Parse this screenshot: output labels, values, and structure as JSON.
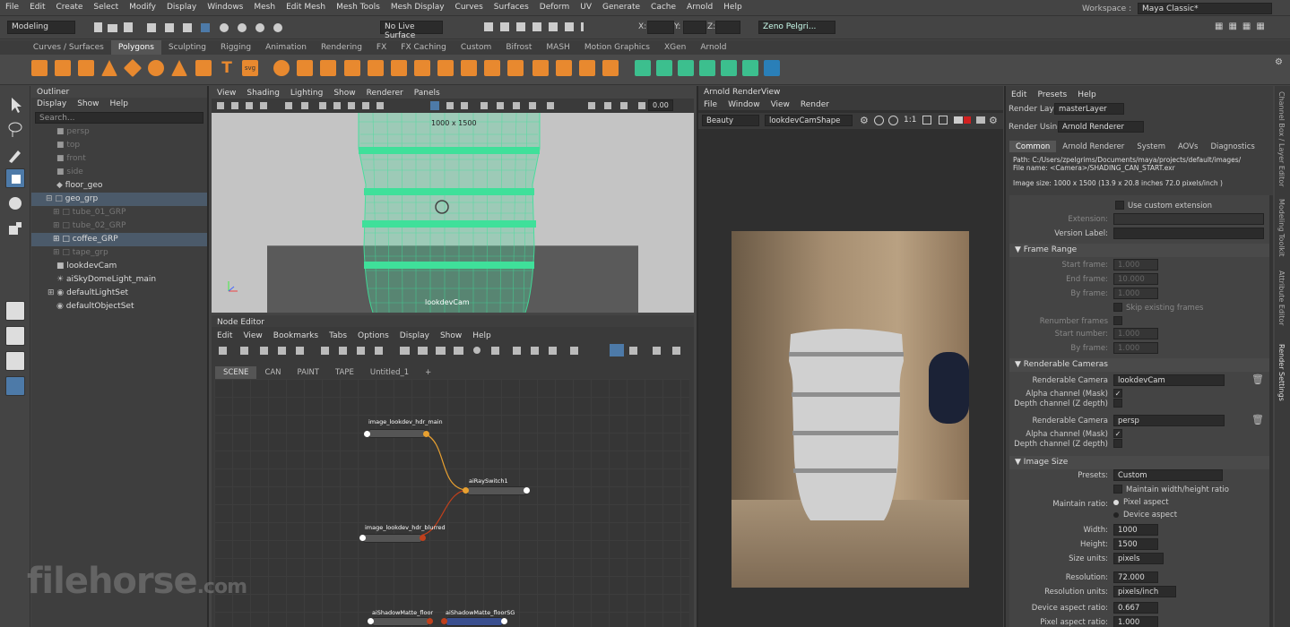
{
  "menubar": {
    "items": [
      "File",
      "Edit",
      "Create",
      "Select",
      "Modify",
      "Display",
      "Windows",
      "Mesh",
      "Edit Mesh",
      "Mesh Tools",
      "Mesh Display",
      "Curves",
      "Surfaces",
      "Deform",
      "UV",
      "Generate",
      "Cache",
      "Arnold",
      "Help"
    ],
    "workspace_label": "Workspace :",
    "workspace_value": "Maya Classic*"
  },
  "statusline": {
    "mode": "Modeling",
    "live_surface": "No Live Surface",
    "x_label": "X:",
    "y_label": "Y:",
    "z_label": "Z:",
    "user": "Zeno Pelgri..."
  },
  "shelf_tabs": [
    "Curves / Surfaces",
    "Polygons",
    "Sculpting",
    "Rigging",
    "Animation",
    "Rendering",
    "FX",
    "FX Caching",
    "Custom",
    "Bifrost",
    "MASH",
    "Motion Graphics",
    "XGen",
    "Arnold"
  ],
  "outliner": {
    "title": "Outliner",
    "menu": [
      "Display",
      "Show",
      "Help"
    ],
    "search_placeholder": "Search...",
    "items": [
      {
        "label": "persp"
      },
      {
        "label": "top"
      },
      {
        "label": "front"
      },
      {
        "label": "side"
      },
      {
        "label": "floor_geo"
      },
      {
        "label": "geo_grp"
      },
      {
        "label": "tube_01_GRP"
      },
      {
        "label": "tube_02_GRP"
      },
      {
        "label": "coffee_GRP"
      },
      {
        "label": "tape_grp"
      },
      {
        "label": "lookdevCam"
      },
      {
        "label": "aiSkyDomeLight_main"
      },
      {
        "label": "defaultLightSet"
      },
      {
        "label": "defaultObjectSet"
      }
    ]
  },
  "viewport": {
    "menu": [
      "View",
      "Shading",
      "Lighting",
      "Show",
      "Renderer",
      "Panels"
    ],
    "value": "0.00",
    "resolution_label": "1000 x 1500",
    "camera_label": "lookdevCam"
  },
  "node_editor": {
    "title": "Node Editor",
    "menu": [
      "Edit",
      "View",
      "Bookmarks",
      "Tabs",
      "Options",
      "Display",
      "Show",
      "Help"
    ],
    "tabs": [
      "SCENE",
      "CAN",
      "PAINT",
      "TAPE",
      "Untitled_1",
      "+"
    ],
    "nodes": [
      "image_lookdev_hdr_main",
      "aiRaySwitch1",
      "image_lookdev_hdr_blurred",
      "aiShadowMatte_floor",
      "aiShadowMatte_floorSG"
    ]
  },
  "render_view": {
    "title": "Arnold RenderView",
    "menu": [
      "File",
      "Window",
      "View",
      "Render"
    ],
    "aov": "Beauty",
    "camera": "lookdevCamShape",
    "ratio": "1:1"
  },
  "render_settings": {
    "menu": [
      "Edit",
      "Presets",
      "Help"
    ],
    "render_layer_label": "Render Layer",
    "render_layer": "masterLayer",
    "render_using_label": "Render Using",
    "render_using": "Arnold Renderer",
    "tabs": [
      "Common",
      "Arnold Renderer",
      "System",
      "AOVs",
      "Diagnostics"
    ],
    "path": "Path: C:/Users/zpelgrims/Documents/maya/projects/default/images/",
    "file_name": "File name:   <Camera>/SHADING_CAN_START.exr",
    "image_size": "Image size: 1000 x 1500 (13.9 x 20.8 inches 72.0 pixels/inch )",
    "use_custom_ext": "Use custom extension",
    "extension_label": "Extension:",
    "version_label": "Version Label:",
    "frame_range": "Frame Range",
    "start_frame_label": "Start frame:",
    "start_frame": "1.000",
    "end_frame_label": "End frame:",
    "end_frame": "10.000",
    "by_frame_label": "By frame:",
    "by_frame": "1.000",
    "skip_frames": "Skip existing frames",
    "renumber_label": "Renumber frames",
    "start_number_label": "Start number:",
    "start_number": "1.000",
    "by_frame2_label": "By frame:",
    "by_frame2": "1.000",
    "renderable_cameras": "Renderable Cameras",
    "rc_label": "Renderable Camera",
    "cam1": "lookdevCam",
    "alpha_label": "Alpha channel (Mask)",
    "depth_label": "Depth channel (Z depth)",
    "cam2": "persp",
    "image_size_sec": "Image Size",
    "presets_label": "Presets:",
    "presets": "Custom",
    "maintain_wh": "Maintain width/height ratio",
    "maintain_label": "Maintain ratio:",
    "pixel_aspect": "Pixel aspect",
    "device_aspect": "Device aspect",
    "width_label": "Width:",
    "width": "1000",
    "height_label": "Height:",
    "height": "1500",
    "size_units_label": "Size units:",
    "size_units": "pixels",
    "resolution_label": "Resolution:",
    "resolution": "72.000",
    "res_units_label": "Resolution units:",
    "res_units": "pixels/inch",
    "device_aspect_label": "Device aspect ratio:",
    "device_aspect_val": "0.667",
    "pixel_aspect_label": "Pixel aspect ratio:",
    "pixel_aspect_val": "1.000"
  },
  "side_tabs": [
    "Channel Box / Layer Editor",
    "Modeling Toolkit",
    "Attribute Editor",
    "Render Settings"
  ],
  "watermark": {
    "main": "filehorse",
    "suffix": ".com"
  }
}
